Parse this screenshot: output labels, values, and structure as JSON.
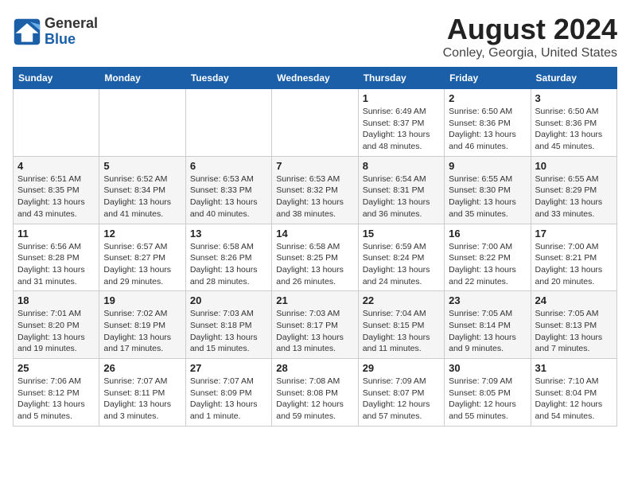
{
  "header": {
    "logo_line1": "General",
    "logo_line2": "Blue",
    "title": "August 2024",
    "subtitle": "Conley, Georgia, United States"
  },
  "days_of_week": [
    "Sunday",
    "Monday",
    "Tuesday",
    "Wednesday",
    "Thursday",
    "Friday",
    "Saturday"
  ],
  "weeks": [
    [
      {
        "day": "",
        "info": ""
      },
      {
        "day": "",
        "info": ""
      },
      {
        "day": "",
        "info": ""
      },
      {
        "day": "",
        "info": ""
      },
      {
        "day": "1",
        "info": "Sunrise: 6:49 AM\nSunset: 8:37 PM\nDaylight: 13 hours\nand 48 minutes."
      },
      {
        "day": "2",
        "info": "Sunrise: 6:50 AM\nSunset: 8:36 PM\nDaylight: 13 hours\nand 46 minutes."
      },
      {
        "day": "3",
        "info": "Sunrise: 6:50 AM\nSunset: 8:36 PM\nDaylight: 13 hours\nand 45 minutes."
      }
    ],
    [
      {
        "day": "4",
        "info": "Sunrise: 6:51 AM\nSunset: 8:35 PM\nDaylight: 13 hours\nand 43 minutes."
      },
      {
        "day": "5",
        "info": "Sunrise: 6:52 AM\nSunset: 8:34 PM\nDaylight: 13 hours\nand 41 minutes."
      },
      {
        "day": "6",
        "info": "Sunrise: 6:53 AM\nSunset: 8:33 PM\nDaylight: 13 hours\nand 40 minutes."
      },
      {
        "day": "7",
        "info": "Sunrise: 6:53 AM\nSunset: 8:32 PM\nDaylight: 13 hours\nand 38 minutes."
      },
      {
        "day": "8",
        "info": "Sunrise: 6:54 AM\nSunset: 8:31 PM\nDaylight: 13 hours\nand 36 minutes."
      },
      {
        "day": "9",
        "info": "Sunrise: 6:55 AM\nSunset: 8:30 PM\nDaylight: 13 hours\nand 35 minutes."
      },
      {
        "day": "10",
        "info": "Sunrise: 6:55 AM\nSunset: 8:29 PM\nDaylight: 13 hours\nand 33 minutes."
      }
    ],
    [
      {
        "day": "11",
        "info": "Sunrise: 6:56 AM\nSunset: 8:28 PM\nDaylight: 13 hours\nand 31 minutes."
      },
      {
        "day": "12",
        "info": "Sunrise: 6:57 AM\nSunset: 8:27 PM\nDaylight: 13 hours\nand 29 minutes."
      },
      {
        "day": "13",
        "info": "Sunrise: 6:58 AM\nSunset: 8:26 PM\nDaylight: 13 hours\nand 28 minutes."
      },
      {
        "day": "14",
        "info": "Sunrise: 6:58 AM\nSunset: 8:25 PM\nDaylight: 13 hours\nand 26 minutes."
      },
      {
        "day": "15",
        "info": "Sunrise: 6:59 AM\nSunset: 8:24 PM\nDaylight: 13 hours\nand 24 minutes."
      },
      {
        "day": "16",
        "info": "Sunrise: 7:00 AM\nSunset: 8:22 PM\nDaylight: 13 hours\nand 22 minutes."
      },
      {
        "day": "17",
        "info": "Sunrise: 7:00 AM\nSunset: 8:21 PM\nDaylight: 13 hours\nand 20 minutes."
      }
    ],
    [
      {
        "day": "18",
        "info": "Sunrise: 7:01 AM\nSunset: 8:20 PM\nDaylight: 13 hours\nand 19 minutes."
      },
      {
        "day": "19",
        "info": "Sunrise: 7:02 AM\nSunset: 8:19 PM\nDaylight: 13 hours\nand 17 minutes."
      },
      {
        "day": "20",
        "info": "Sunrise: 7:03 AM\nSunset: 8:18 PM\nDaylight: 13 hours\nand 15 minutes."
      },
      {
        "day": "21",
        "info": "Sunrise: 7:03 AM\nSunset: 8:17 PM\nDaylight: 13 hours\nand 13 minutes."
      },
      {
        "day": "22",
        "info": "Sunrise: 7:04 AM\nSunset: 8:15 PM\nDaylight: 13 hours\nand 11 minutes."
      },
      {
        "day": "23",
        "info": "Sunrise: 7:05 AM\nSunset: 8:14 PM\nDaylight: 13 hours\nand 9 minutes."
      },
      {
        "day": "24",
        "info": "Sunrise: 7:05 AM\nSunset: 8:13 PM\nDaylight: 13 hours\nand 7 minutes."
      }
    ],
    [
      {
        "day": "25",
        "info": "Sunrise: 7:06 AM\nSunset: 8:12 PM\nDaylight: 13 hours\nand 5 minutes."
      },
      {
        "day": "26",
        "info": "Sunrise: 7:07 AM\nSunset: 8:11 PM\nDaylight: 13 hours\nand 3 minutes."
      },
      {
        "day": "27",
        "info": "Sunrise: 7:07 AM\nSunset: 8:09 PM\nDaylight: 13 hours\nand 1 minute."
      },
      {
        "day": "28",
        "info": "Sunrise: 7:08 AM\nSunset: 8:08 PM\nDaylight: 12 hours\nand 59 minutes."
      },
      {
        "day": "29",
        "info": "Sunrise: 7:09 AM\nSunset: 8:07 PM\nDaylight: 12 hours\nand 57 minutes."
      },
      {
        "day": "30",
        "info": "Sunrise: 7:09 AM\nSunset: 8:05 PM\nDaylight: 12 hours\nand 55 minutes."
      },
      {
        "day": "31",
        "info": "Sunrise: 7:10 AM\nSunset: 8:04 PM\nDaylight: 12 hours\nand 54 minutes."
      }
    ]
  ]
}
